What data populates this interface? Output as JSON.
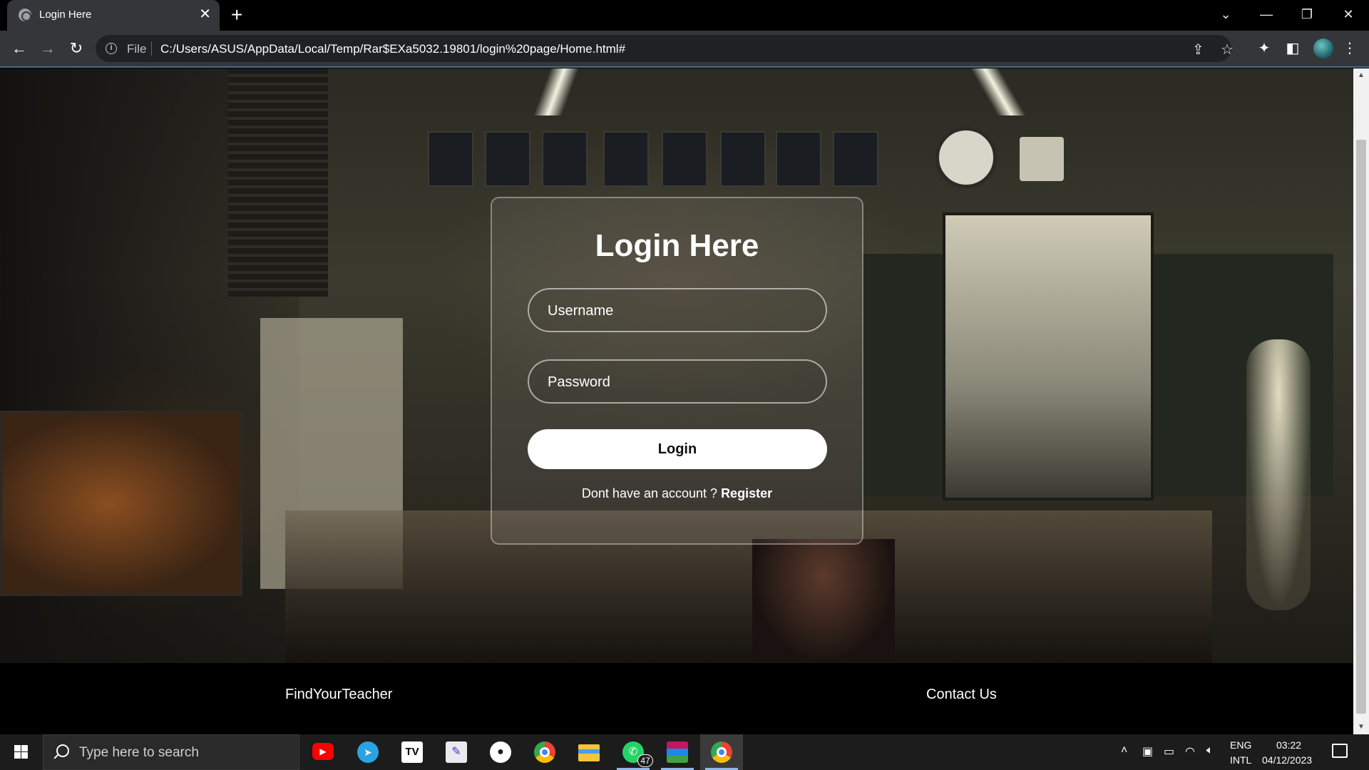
{
  "browser": {
    "tab_title": "Login Here",
    "tab_close": "✕",
    "new_tab": "+",
    "file_label": "File",
    "url": "C:/Users/ASUS/AppData/Local/Temp/Rar$EXa5032.19801/login%20page/Home.html#",
    "window_controls": {
      "tab_list": "⌄",
      "minimize": "—",
      "restore": "❐",
      "close": "✕"
    }
  },
  "login": {
    "title": "Login Here",
    "username_placeholder": "Username",
    "password_placeholder": "Password",
    "button_label": "Login",
    "register_prompt": "Dont have an account ?",
    "register_link": "Register"
  },
  "footer": {
    "brand": "FindYourTeacher",
    "contact": "Contact Us"
  },
  "taskbar": {
    "search_placeholder": "Type here to search",
    "whatsapp_badge": "47",
    "language_1": "ENG",
    "language_2": "INTL",
    "time": "03:22",
    "date": "04/12/2023",
    "apps": [
      "youtube-icon",
      "telegram-icon",
      "tradingview-icon",
      "notes-app-icon",
      "github-icon",
      "chrome-icon",
      "file-explorer-icon",
      "whatsapp-icon",
      "winrar-icon",
      "chrome-icon"
    ]
  },
  "colors": {
    "card_border": "#ffffff",
    "button_bg": "#ffffff",
    "footer_bg": "#000000",
    "chrome_toolbar": "#35363a"
  }
}
